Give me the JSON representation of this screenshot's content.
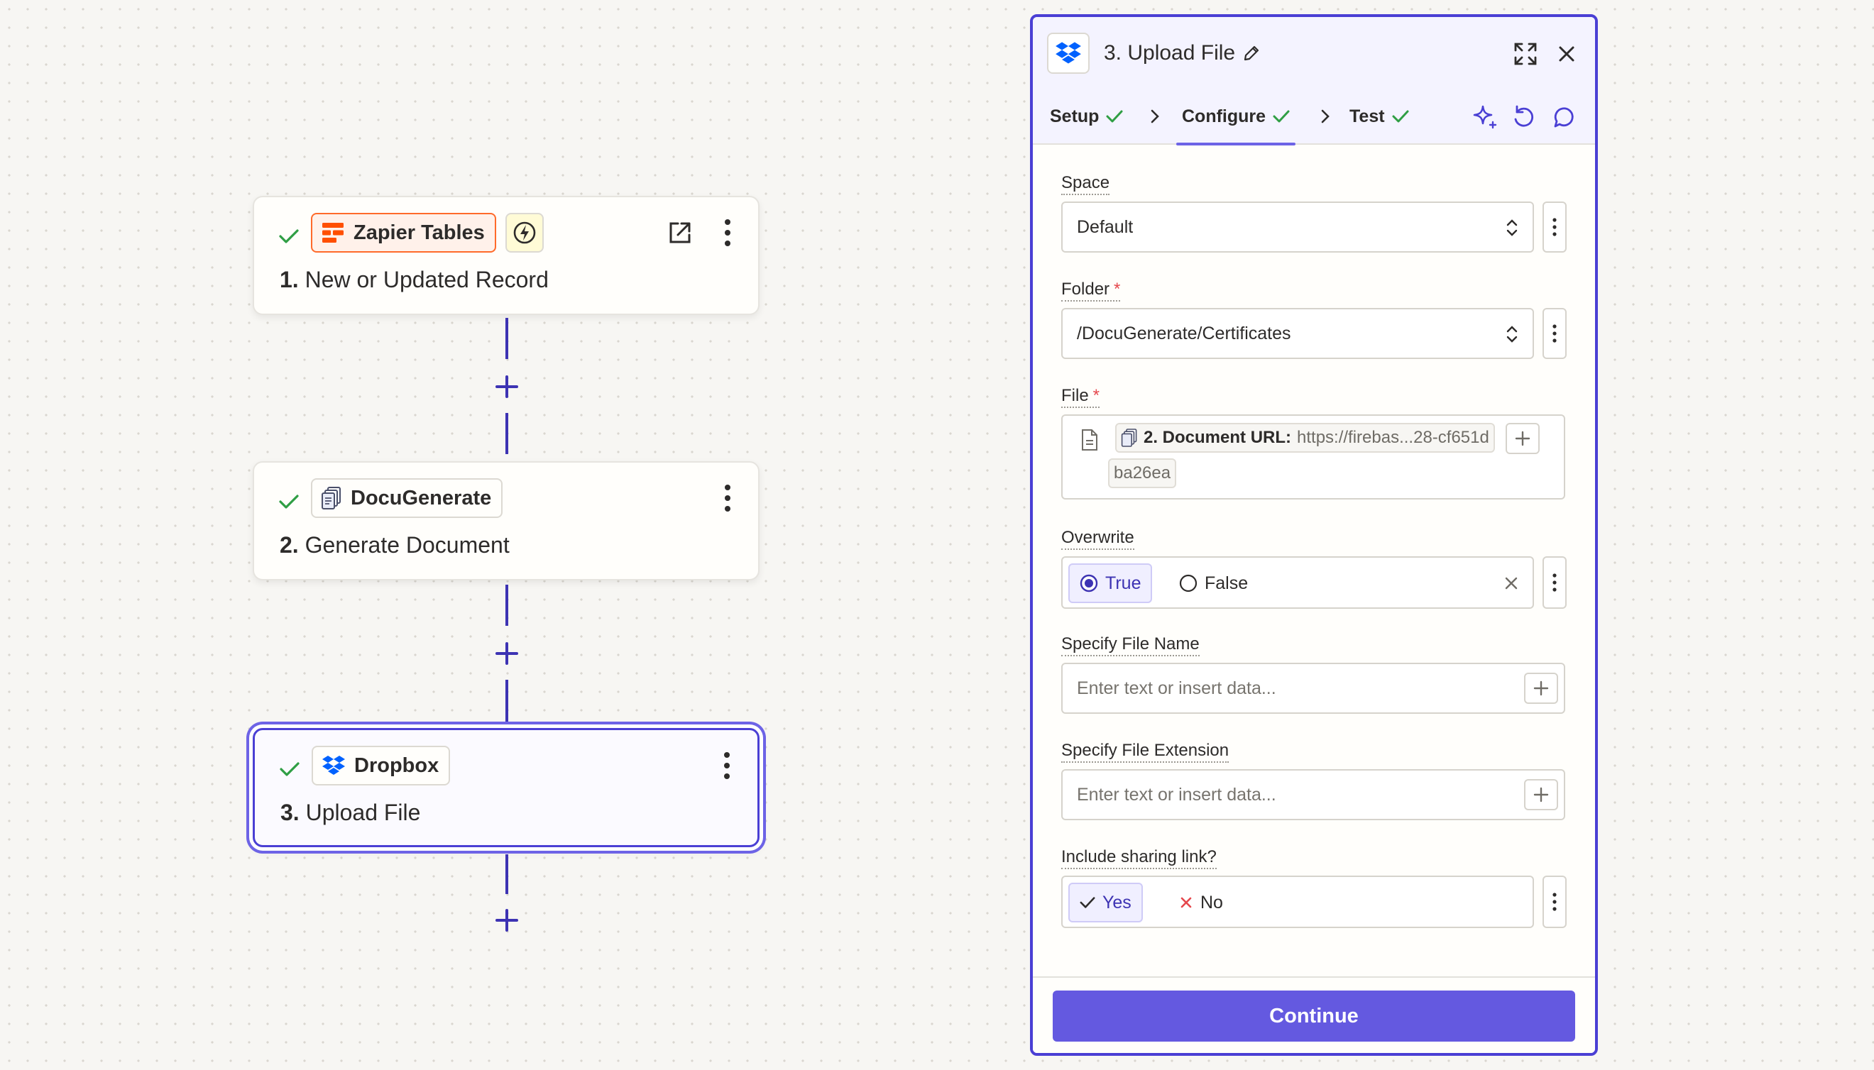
{
  "canvas": {
    "steps": [
      {
        "app": "Zapier Tables",
        "number": "1.",
        "title": "New or Updated Record",
        "status": "complete",
        "app_icon": "zapier-tables-icon",
        "trigger_icon": "lightning-icon"
      },
      {
        "app": "DocuGenerate",
        "number": "2.",
        "title": "Generate Document",
        "status": "complete",
        "app_icon": "docugenerate-icon"
      },
      {
        "app": "Dropbox",
        "number": "3.",
        "title": "Upload File",
        "status": "complete",
        "app_icon": "dropbox-icon",
        "selected": true
      }
    ]
  },
  "panel": {
    "title": "3. Upload File",
    "tabs": [
      {
        "label": "Setup",
        "complete": true
      },
      {
        "label": "Configure",
        "complete": true,
        "active": true
      },
      {
        "label": "Test",
        "complete": true
      }
    ],
    "fields": {
      "space": {
        "label": "Space",
        "value": "Default"
      },
      "folder": {
        "label": "Folder",
        "required_mark": "*",
        "value": "/DocuGenerate/Certificates"
      },
      "file": {
        "label": "File",
        "required_mark": "*",
        "pill_key": "2. Document URL:",
        "pill_value": "https://firebas...28-cf651d",
        "pill_value_cont": "ba26ea"
      },
      "overwrite": {
        "label": "Overwrite",
        "option_true": "True",
        "option_false": "False",
        "selected": "True"
      },
      "file_name": {
        "label": "Specify File Name",
        "placeholder": "Enter text or insert data..."
      },
      "file_extension": {
        "label": "Specify File Extension",
        "placeholder": "Enter text or insert data..."
      },
      "sharing_link": {
        "label": "Include sharing link?",
        "option_yes": "Yes",
        "option_no": "No",
        "selected": "Yes"
      }
    },
    "continue_label": "Continue"
  },
  "colors": {
    "accent": "#6459e0",
    "accent_dark": "#4a3fd4",
    "success": "#2f9e44",
    "required": "#e5484d",
    "zapier_orange": "#ff4f00",
    "dropbox_blue": "#0061fe"
  }
}
